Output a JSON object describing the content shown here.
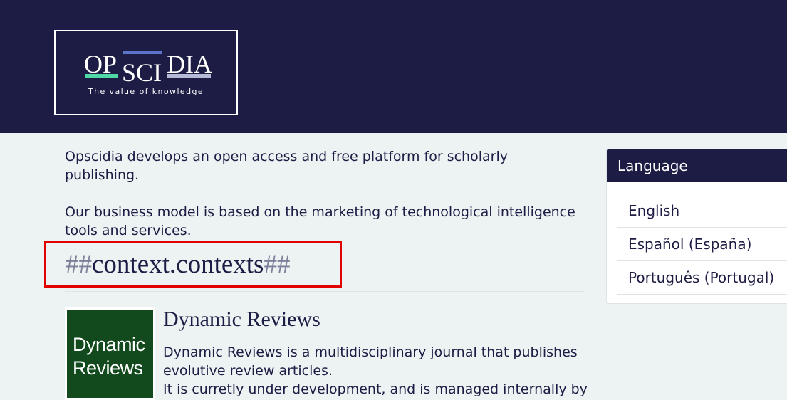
{
  "header": {
    "logo": {
      "word_op": "OP",
      "word_sci": "SCI",
      "word_dia": "DIA",
      "tagline": "The value of knowledge"
    }
  },
  "main": {
    "intro": [
      "Opscidia develops an open access and free platform for scholarly publishing.",
      "Our business model is based on the marketing of technological intelligence tools and services."
    ],
    "context_heading": {
      "prefix": "##",
      "text": "context.contexts",
      "suffix": "##"
    },
    "journal": {
      "cover_line1": "Dynamic",
      "cover_line2": "Reviews",
      "title": "Dynamic Reviews",
      "description_1": "Dynamic Reviews is a multidisciplinary journal that publishes evolutive review articles.",
      "description_2": "It is curretly under development, and is managed internally by"
    }
  },
  "sidebar": {
    "title": "Language",
    "languages": [
      "English",
      "Español (España)",
      "Português (Portugal)"
    ]
  },
  "colors": {
    "header_bg": "#1d1c44",
    "page_bg": "#edf2f3",
    "highlight_border": "#e00000",
    "logo_green": "#4fd9a6",
    "logo_blue": "#5b73c9",
    "logo_gray": "#b5bad6",
    "cover_green": "#124a1e"
  }
}
